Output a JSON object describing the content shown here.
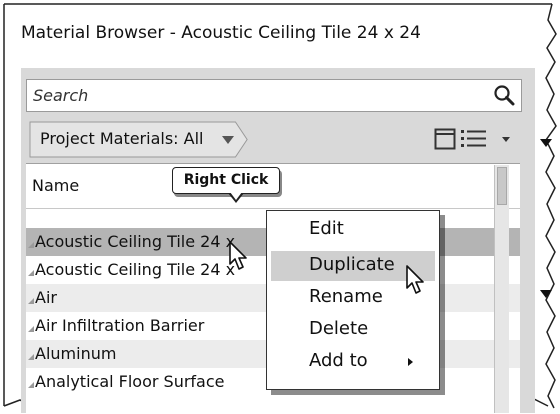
{
  "window": {
    "title": "Material Browser - Acoustic Ceiling Tile 24 x 24"
  },
  "search": {
    "placeholder": "Search",
    "icon": "search-icon"
  },
  "toolbar": {
    "filter_label": "Project Materials: All",
    "filter_icon": "dropdown-triangle-icon",
    "view_icons": [
      "panel-view-icon",
      "list-view-icon"
    ]
  },
  "list": {
    "column_header": "Name",
    "rows": [
      {
        "label": "Acoustic Ceiling Tile 24 x",
        "selected": true
      },
      {
        "label": "Acoustic Ceiling Tile 24 x",
        "selected": false
      },
      {
        "label": "Air",
        "selected": false
      },
      {
        "label": "Air Infiltration Barrier",
        "selected": false
      },
      {
        "label": "Aluminum",
        "selected": false
      },
      {
        "label": "Analytical Floor Surface",
        "selected": false
      }
    ]
  },
  "annotation": {
    "callout": "Right Click"
  },
  "context_menu": {
    "items": [
      {
        "label": "Edit"
      },
      {
        "label": "Duplicate",
        "highlighted": true
      },
      {
        "label": "Rename"
      },
      {
        "label": "Delete"
      },
      {
        "label": "Add to",
        "submenu": true
      }
    ]
  },
  "colors": {
    "panel": "#d9d9d9",
    "selected_row": "#b4b4b4",
    "menu_highlight": "#cfcfcf"
  }
}
